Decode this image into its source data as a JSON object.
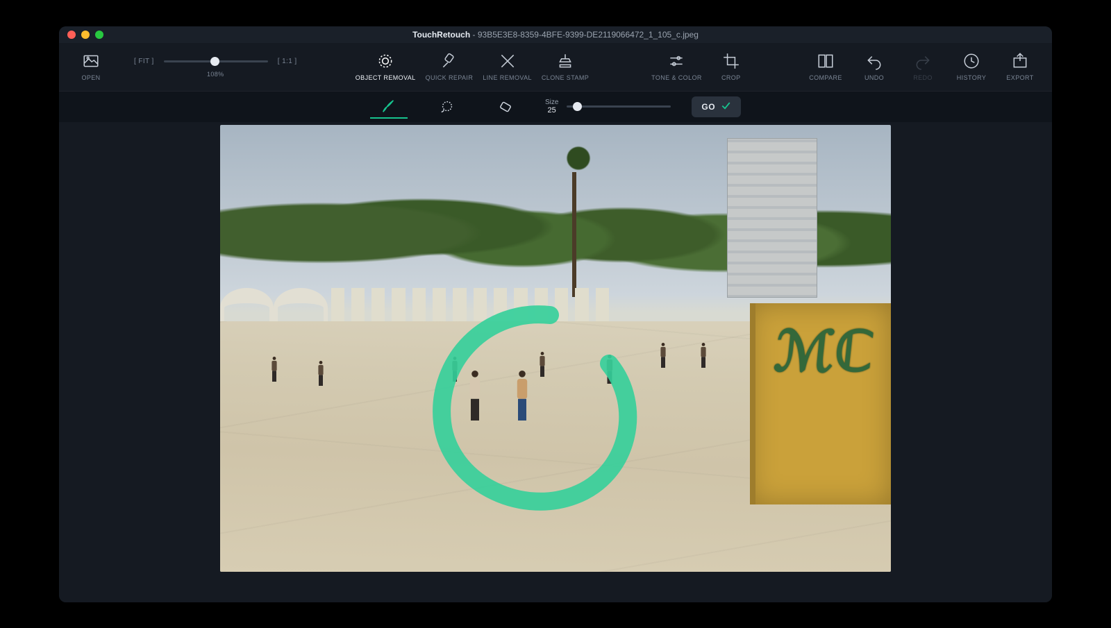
{
  "app_name": "TouchRetouch",
  "file_name": "93B5E3E8-8359-4BFE-9399-DE2119066472_1_105_c.jpeg",
  "top_toolbar": {
    "open": "OPEN",
    "fit": "FIT",
    "one_to_one": "1:1",
    "zoom_percentage": "108%",
    "object_removal": "OBJECT REMOVAL",
    "quick_repair": "QUICK REPAIR",
    "line_removal": "LINE REMOVAL",
    "clone_stamp": "CLONE STAMP",
    "tone_color": "TONE & COLOR",
    "crop": "CROP",
    "compare": "COMPARE",
    "undo": "UNDO",
    "redo": "REDO",
    "history": "HISTORY",
    "export": "EXPORT"
  },
  "sub_toolbar": {
    "size_label": "Size",
    "size_value": "25",
    "go_label": "GO"
  },
  "colors": {
    "accent": "#17c38e",
    "brush": "#34cf9a"
  }
}
